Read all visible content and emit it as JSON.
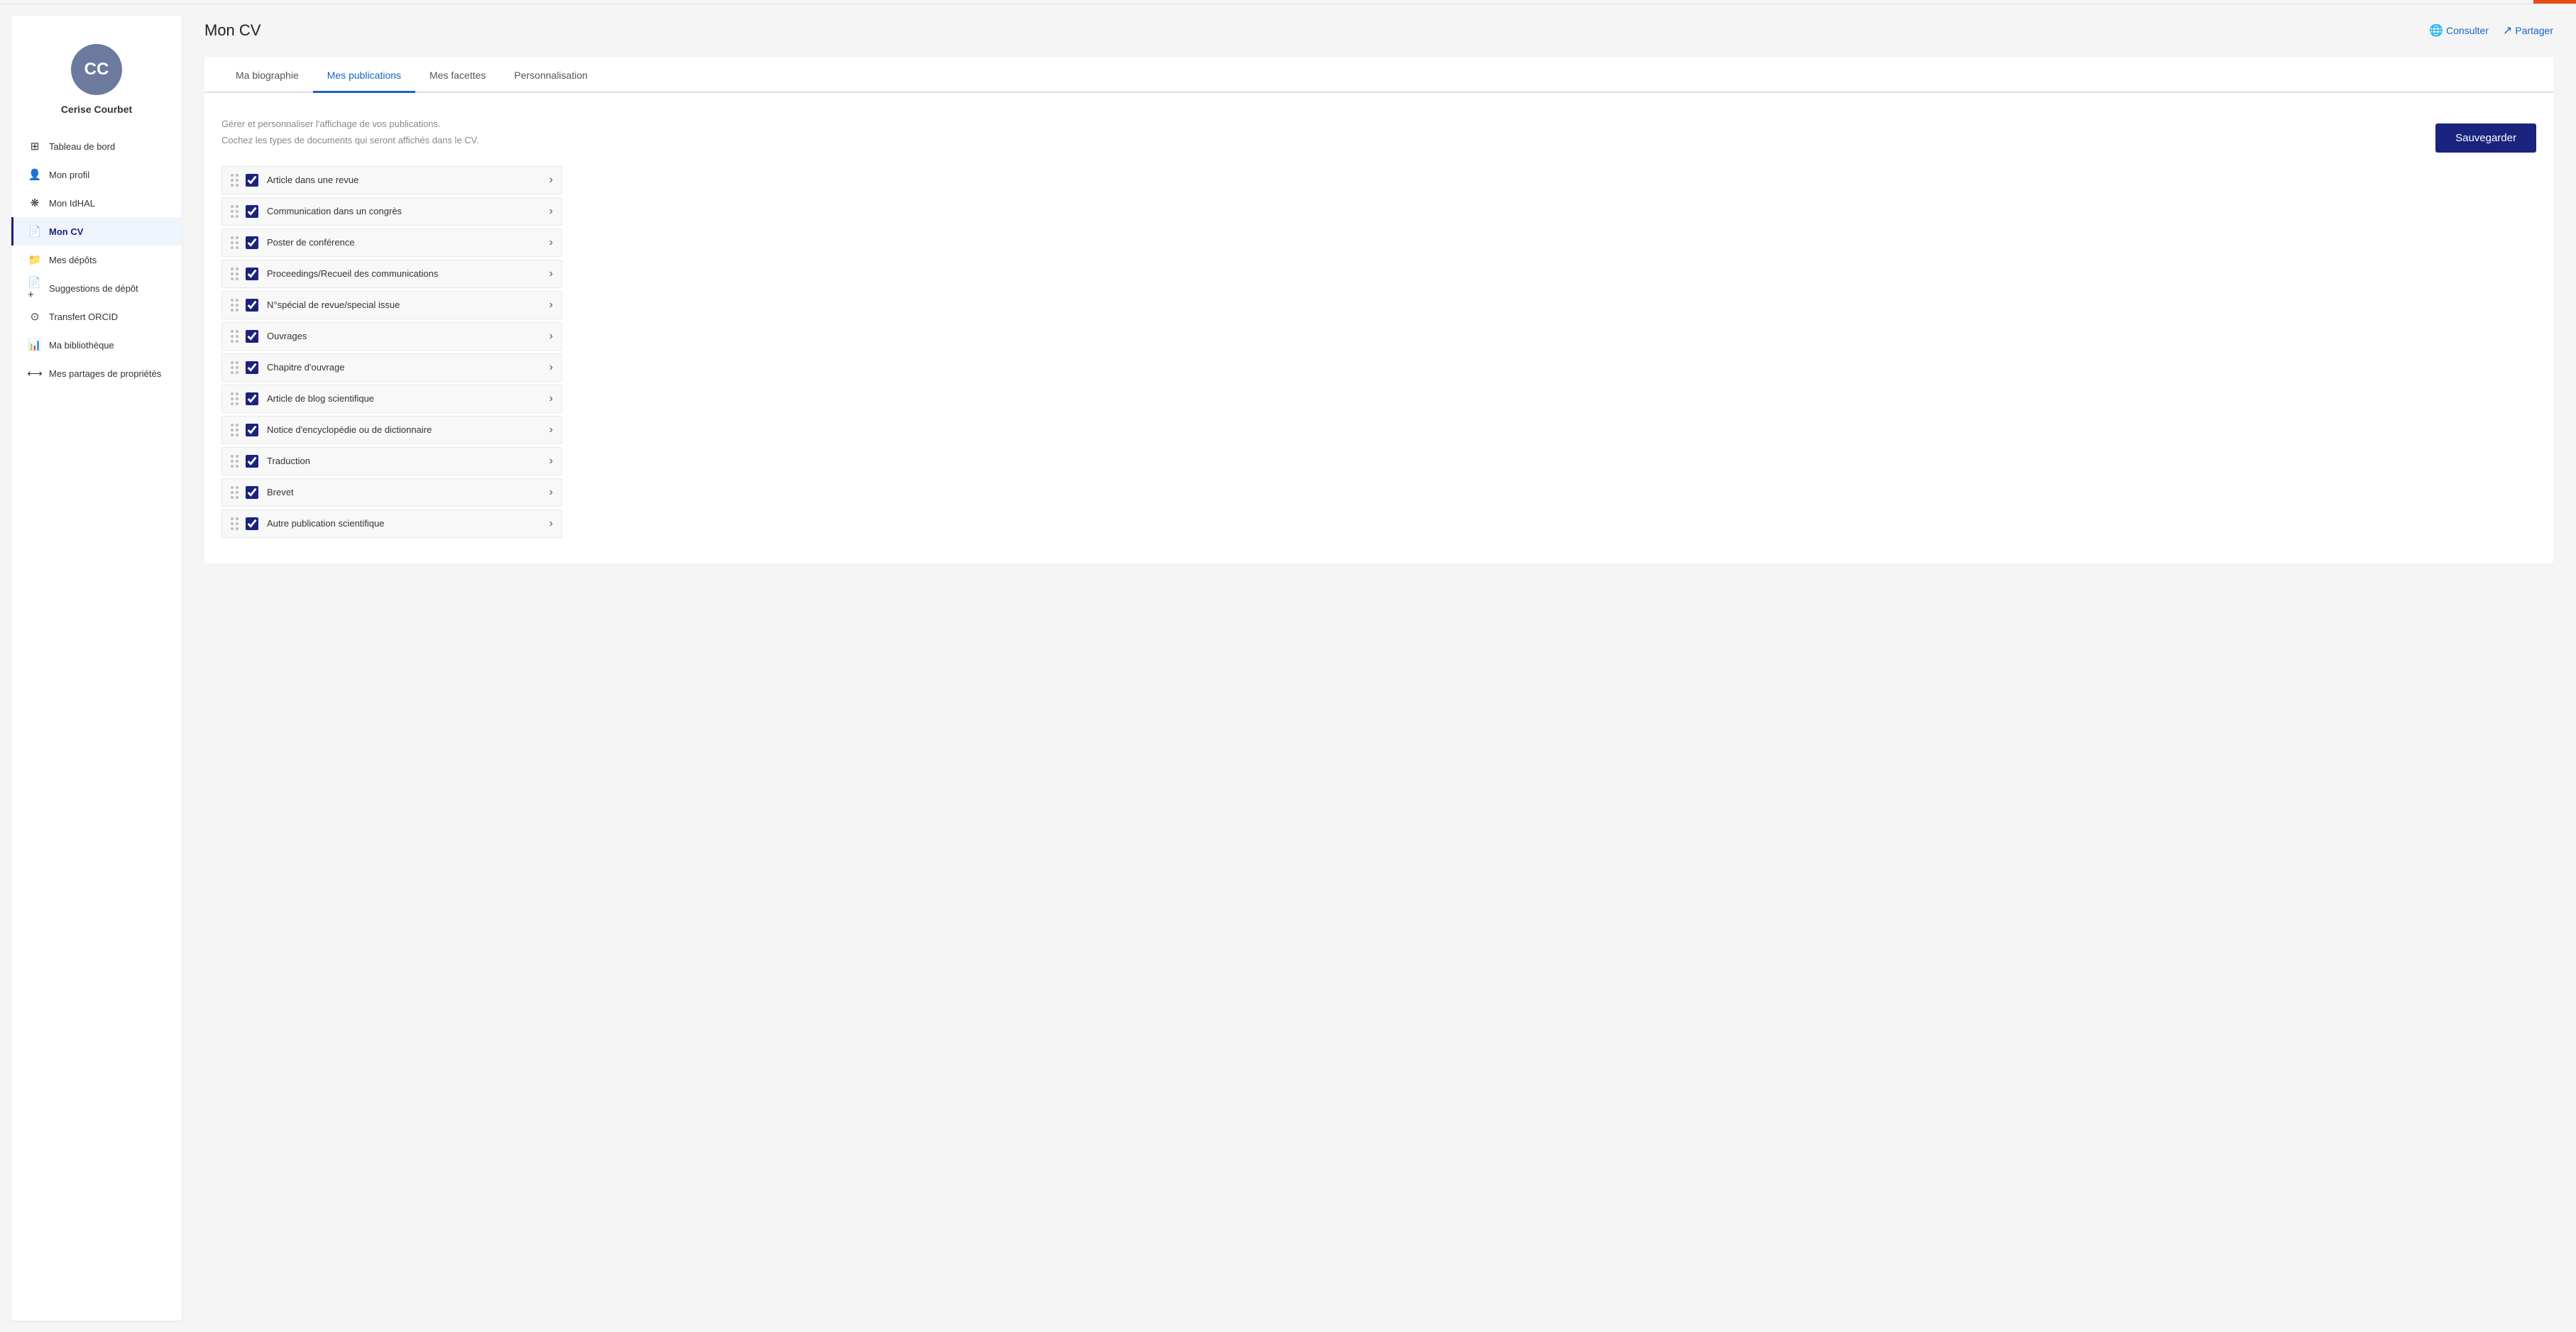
{
  "topbar": {
    "orange_accent": true
  },
  "sidebar": {
    "user": {
      "initials": "CC",
      "name": "Cerise Courbet"
    },
    "nav_items": [
      {
        "id": "tableau-de-bord",
        "label": "Tableau de bord",
        "icon": "⊞",
        "active": false
      },
      {
        "id": "mon-profil",
        "label": "Mon profil",
        "icon": "👤",
        "active": false
      },
      {
        "id": "mon-idhal",
        "label": "Mon IdHAL",
        "icon": "❋",
        "active": false
      },
      {
        "id": "mon-cv",
        "label": "Mon CV",
        "icon": "📄",
        "active": true
      },
      {
        "id": "mes-depots",
        "label": "Mes dépôts",
        "icon": "📁",
        "active": false
      },
      {
        "id": "suggestions-de-depot",
        "label": "Suggestions de dépôt",
        "icon": "📄+",
        "active": false
      },
      {
        "id": "transfert-orcid",
        "label": "Transfert ORCID",
        "icon": "⊙",
        "active": false
      },
      {
        "id": "ma-bibliotheque",
        "label": "Ma bibliothèque",
        "icon": "📊",
        "active": false
      },
      {
        "id": "mes-partages-de-proprietes",
        "label": "Mes partages de propriétés",
        "icon": "⟷",
        "active": false
      }
    ]
  },
  "page": {
    "title": "Mon CV",
    "header_actions": [
      {
        "id": "consulter",
        "label": "Consulter",
        "icon": "🌐"
      },
      {
        "id": "partager",
        "label": "Partager",
        "icon": "↗"
      }
    ]
  },
  "tabs": [
    {
      "id": "ma-biographie",
      "label": "Ma biographie",
      "active": false
    },
    {
      "id": "mes-publications",
      "label": "Mes publications",
      "active": true
    },
    {
      "id": "mes-facettes",
      "label": "Mes facettes",
      "active": false
    },
    {
      "id": "personnalisation",
      "label": "Personnalisation",
      "active": false
    }
  ],
  "content": {
    "description_line1": "Gérer et personnaliser l'affichage de vos publications.",
    "description_line2": "Cochez les types de documents qui seront affichés dans le CV.",
    "save_button_label": "Sauvegarder",
    "publications": [
      {
        "id": "article-revue",
        "label": "Article dans une revue",
        "checked": true
      },
      {
        "id": "communication-congres",
        "label": "Communication dans un congrès",
        "checked": true
      },
      {
        "id": "poster-conference",
        "label": "Poster de conférence",
        "checked": true
      },
      {
        "id": "proceedings-recueil",
        "label": "Proceedings/Recueil des communications",
        "checked": true
      },
      {
        "id": "nspecial-revue",
        "label": "N°spécial de revue/special issue",
        "checked": true
      },
      {
        "id": "ouvrages",
        "label": "Ouvrages",
        "checked": true
      },
      {
        "id": "chapitre-ouvrage",
        "label": "Chapitre d'ouvrage",
        "checked": true
      },
      {
        "id": "article-blog",
        "label": "Article de blog scientifique",
        "checked": true
      },
      {
        "id": "notice-encyclopedie",
        "label": "Notice d'encyclopédie ou de dictionnaire",
        "checked": true
      },
      {
        "id": "traduction",
        "label": "Traduction",
        "checked": true
      },
      {
        "id": "brevet",
        "label": "Brevet",
        "checked": true
      },
      {
        "id": "autre-publication",
        "label": "Autre publication scientifique",
        "checked": true
      }
    ]
  }
}
